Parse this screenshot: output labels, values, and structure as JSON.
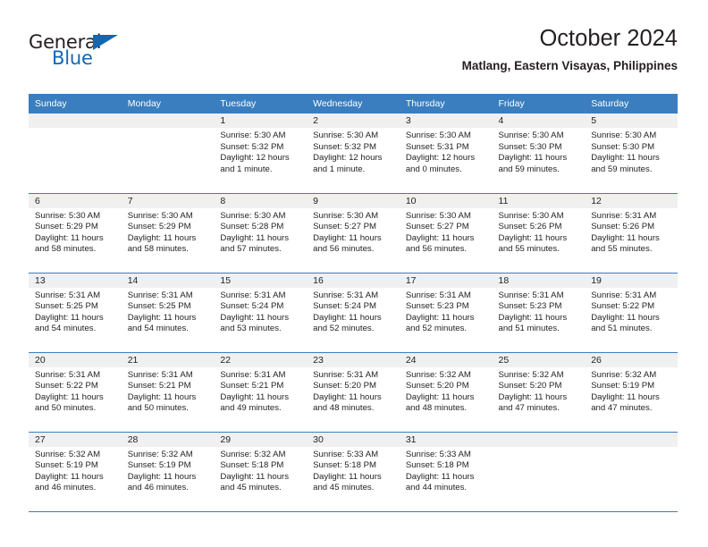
{
  "logo": {
    "word_top": "General",
    "word_bottom": "Blue",
    "accent_color": "#1268b3"
  },
  "header": {
    "title": "October 2024",
    "subtitle": "Matlang, Eastern Visayas, Philippines"
  },
  "theme": {
    "header_row_color": "#3a7ebf",
    "daynum_band_color": "#f0f0f0",
    "text_color": "#231f20"
  },
  "weekday_headers": [
    "Sunday",
    "Monday",
    "Tuesday",
    "Wednesday",
    "Thursday",
    "Friday",
    "Saturday"
  ],
  "weeks": [
    [
      {
        "day": "",
        "sunrise": "",
        "sunset": "",
        "daylight_1": "",
        "daylight_2": ""
      },
      {
        "day": "",
        "sunrise": "",
        "sunset": "",
        "daylight_1": "",
        "daylight_2": ""
      },
      {
        "day": "1",
        "sunrise": "Sunrise: 5:30 AM",
        "sunset": "Sunset: 5:32 PM",
        "daylight_1": "Daylight: 12 hours",
        "daylight_2": "and 1 minute."
      },
      {
        "day": "2",
        "sunrise": "Sunrise: 5:30 AM",
        "sunset": "Sunset: 5:32 PM",
        "daylight_1": "Daylight: 12 hours",
        "daylight_2": "and 1 minute."
      },
      {
        "day": "3",
        "sunrise": "Sunrise: 5:30 AM",
        "sunset": "Sunset: 5:31 PM",
        "daylight_1": "Daylight: 12 hours",
        "daylight_2": "and 0 minutes."
      },
      {
        "day": "4",
        "sunrise": "Sunrise: 5:30 AM",
        "sunset": "Sunset: 5:30 PM",
        "daylight_1": "Daylight: 11 hours",
        "daylight_2": "and 59 minutes."
      },
      {
        "day": "5",
        "sunrise": "Sunrise: 5:30 AM",
        "sunset": "Sunset: 5:30 PM",
        "daylight_1": "Daylight: 11 hours",
        "daylight_2": "and 59 minutes."
      }
    ],
    [
      {
        "day": "6",
        "sunrise": "Sunrise: 5:30 AM",
        "sunset": "Sunset: 5:29 PM",
        "daylight_1": "Daylight: 11 hours",
        "daylight_2": "and 58 minutes."
      },
      {
        "day": "7",
        "sunrise": "Sunrise: 5:30 AM",
        "sunset": "Sunset: 5:29 PM",
        "daylight_1": "Daylight: 11 hours",
        "daylight_2": "and 58 minutes."
      },
      {
        "day": "8",
        "sunrise": "Sunrise: 5:30 AM",
        "sunset": "Sunset: 5:28 PM",
        "daylight_1": "Daylight: 11 hours",
        "daylight_2": "and 57 minutes."
      },
      {
        "day": "9",
        "sunrise": "Sunrise: 5:30 AM",
        "sunset": "Sunset: 5:27 PM",
        "daylight_1": "Daylight: 11 hours",
        "daylight_2": "and 56 minutes."
      },
      {
        "day": "10",
        "sunrise": "Sunrise: 5:30 AM",
        "sunset": "Sunset: 5:27 PM",
        "daylight_1": "Daylight: 11 hours",
        "daylight_2": "and 56 minutes."
      },
      {
        "day": "11",
        "sunrise": "Sunrise: 5:30 AM",
        "sunset": "Sunset: 5:26 PM",
        "daylight_1": "Daylight: 11 hours",
        "daylight_2": "and 55 minutes."
      },
      {
        "day": "12",
        "sunrise": "Sunrise: 5:31 AM",
        "sunset": "Sunset: 5:26 PM",
        "daylight_1": "Daylight: 11 hours",
        "daylight_2": "and 55 minutes."
      }
    ],
    [
      {
        "day": "13",
        "sunrise": "Sunrise: 5:31 AM",
        "sunset": "Sunset: 5:25 PM",
        "daylight_1": "Daylight: 11 hours",
        "daylight_2": "and 54 minutes."
      },
      {
        "day": "14",
        "sunrise": "Sunrise: 5:31 AM",
        "sunset": "Sunset: 5:25 PM",
        "daylight_1": "Daylight: 11 hours",
        "daylight_2": "and 54 minutes."
      },
      {
        "day": "15",
        "sunrise": "Sunrise: 5:31 AM",
        "sunset": "Sunset: 5:24 PM",
        "daylight_1": "Daylight: 11 hours",
        "daylight_2": "and 53 minutes."
      },
      {
        "day": "16",
        "sunrise": "Sunrise: 5:31 AM",
        "sunset": "Sunset: 5:24 PM",
        "daylight_1": "Daylight: 11 hours",
        "daylight_2": "and 52 minutes."
      },
      {
        "day": "17",
        "sunrise": "Sunrise: 5:31 AM",
        "sunset": "Sunset: 5:23 PM",
        "daylight_1": "Daylight: 11 hours",
        "daylight_2": "and 52 minutes."
      },
      {
        "day": "18",
        "sunrise": "Sunrise: 5:31 AM",
        "sunset": "Sunset: 5:23 PM",
        "daylight_1": "Daylight: 11 hours",
        "daylight_2": "and 51 minutes."
      },
      {
        "day": "19",
        "sunrise": "Sunrise: 5:31 AM",
        "sunset": "Sunset: 5:22 PM",
        "daylight_1": "Daylight: 11 hours",
        "daylight_2": "and 51 minutes."
      }
    ],
    [
      {
        "day": "20",
        "sunrise": "Sunrise: 5:31 AM",
        "sunset": "Sunset: 5:22 PM",
        "daylight_1": "Daylight: 11 hours",
        "daylight_2": "and 50 minutes."
      },
      {
        "day": "21",
        "sunrise": "Sunrise: 5:31 AM",
        "sunset": "Sunset: 5:21 PM",
        "daylight_1": "Daylight: 11 hours",
        "daylight_2": "and 50 minutes."
      },
      {
        "day": "22",
        "sunrise": "Sunrise: 5:31 AM",
        "sunset": "Sunset: 5:21 PM",
        "daylight_1": "Daylight: 11 hours",
        "daylight_2": "and 49 minutes."
      },
      {
        "day": "23",
        "sunrise": "Sunrise: 5:31 AM",
        "sunset": "Sunset: 5:20 PM",
        "daylight_1": "Daylight: 11 hours",
        "daylight_2": "and 48 minutes."
      },
      {
        "day": "24",
        "sunrise": "Sunrise: 5:32 AM",
        "sunset": "Sunset: 5:20 PM",
        "daylight_1": "Daylight: 11 hours",
        "daylight_2": "and 48 minutes."
      },
      {
        "day": "25",
        "sunrise": "Sunrise: 5:32 AM",
        "sunset": "Sunset: 5:20 PM",
        "daylight_1": "Daylight: 11 hours",
        "daylight_2": "and 47 minutes."
      },
      {
        "day": "26",
        "sunrise": "Sunrise: 5:32 AM",
        "sunset": "Sunset: 5:19 PM",
        "daylight_1": "Daylight: 11 hours",
        "daylight_2": "and 47 minutes."
      }
    ],
    [
      {
        "day": "27",
        "sunrise": "Sunrise: 5:32 AM",
        "sunset": "Sunset: 5:19 PM",
        "daylight_1": "Daylight: 11 hours",
        "daylight_2": "and 46 minutes."
      },
      {
        "day": "28",
        "sunrise": "Sunrise: 5:32 AM",
        "sunset": "Sunset: 5:19 PM",
        "daylight_1": "Daylight: 11 hours",
        "daylight_2": "and 46 minutes."
      },
      {
        "day": "29",
        "sunrise": "Sunrise: 5:32 AM",
        "sunset": "Sunset: 5:18 PM",
        "daylight_1": "Daylight: 11 hours",
        "daylight_2": "and 45 minutes."
      },
      {
        "day": "30",
        "sunrise": "Sunrise: 5:33 AM",
        "sunset": "Sunset: 5:18 PM",
        "daylight_1": "Daylight: 11 hours",
        "daylight_2": "and 45 minutes."
      },
      {
        "day": "31",
        "sunrise": "Sunrise: 5:33 AM",
        "sunset": "Sunset: 5:18 PM",
        "daylight_1": "Daylight: 11 hours",
        "daylight_2": "and 44 minutes."
      },
      {
        "day": "",
        "sunrise": "",
        "sunset": "",
        "daylight_1": "",
        "daylight_2": ""
      },
      {
        "day": "",
        "sunrise": "",
        "sunset": "",
        "daylight_1": "",
        "daylight_2": ""
      }
    ]
  ]
}
